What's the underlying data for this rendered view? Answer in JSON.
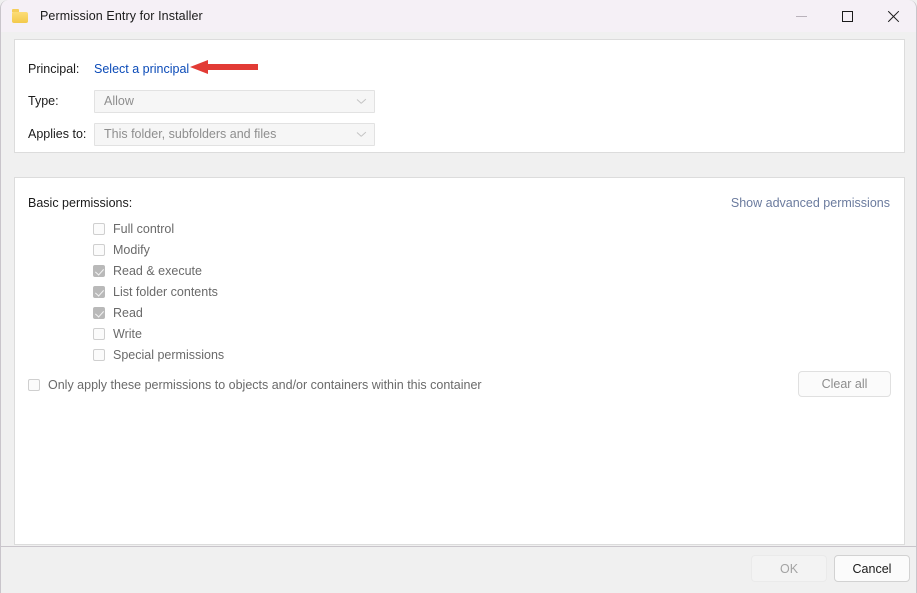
{
  "window": {
    "title": "Permission Entry for Installer",
    "icon": "folder-icon",
    "controls": {
      "minimize": "minimize-icon",
      "maximize": "maximize-icon",
      "close": "close-icon"
    }
  },
  "principal_section": {
    "principal_label": "Principal:",
    "principal_link": "Select a principal",
    "type_label": "Type:",
    "type_value": "Allow",
    "applies_to_label": "Applies to:",
    "applies_to_value": "This folder, subfolders and files"
  },
  "annotation": {
    "arrow_color": "#e23b35",
    "points_to": "Select a principal"
  },
  "permissions_section": {
    "heading": "Basic permissions:",
    "advanced_link": "Show advanced permissions",
    "items": [
      {
        "label": "Full control",
        "checked": false
      },
      {
        "label": "Modify",
        "checked": false
      },
      {
        "label": "Read & execute",
        "checked": true
      },
      {
        "label": "List folder contents",
        "checked": true
      },
      {
        "label": "Read",
        "checked": true
      },
      {
        "label": "Write",
        "checked": false
      },
      {
        "label": "Special permissions",
        "checked": false
      }
    ],
    "only_apply_label": "Only apply these permissions to objects and/or containers within this container",
    "only_apply_checked": false,
    "clear_all_label": "Clear all"
  },
  "footer": {
    "ok_label": "OK",
    "ok_enabled": false,
    "cancel_label": "Cancel",
    "cancel_enabled": true
  },
  "colors": {
    "link": "#0b4bb8",
    "advanced_link": "#6b7b9e",
    "titlebar": "#f5f0f6",
    "panel_bg": "#ffffff",
    "dialog_bg": "#f0f0f0",
    "annotation": "#e23b35"
  }
}
